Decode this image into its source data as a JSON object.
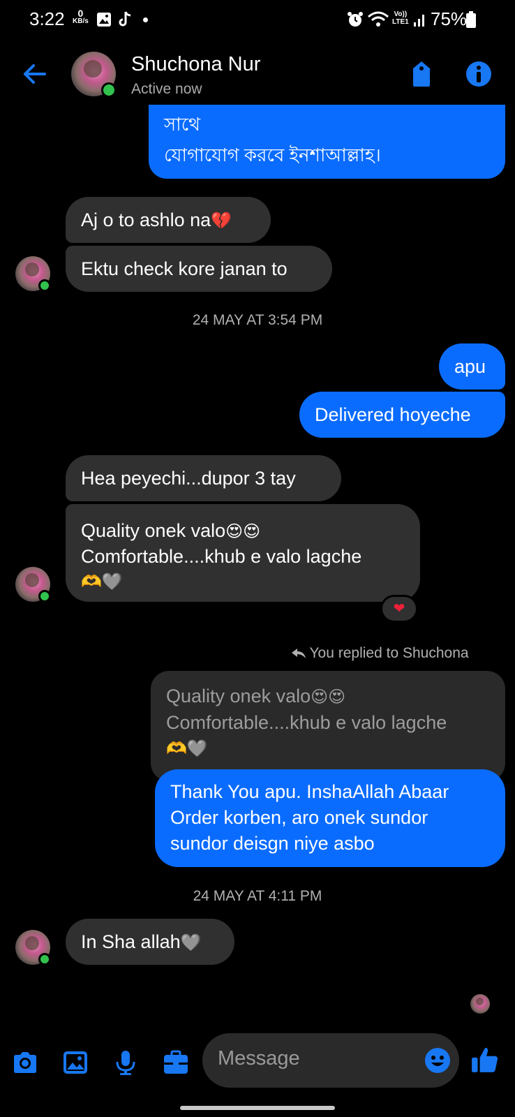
{
  "status_bar": {
    "time": "3:22",
    "net_speed_value": "0",
    "net_speed_unit": "KB/s",
    "volte_line1": "Vo))",
    "volte_line2": "LTE1",
    "battery": "75%"
  },
  "header": {
    "contact_name": "Shuchona Nur",
    "contact_status": "Active now"
  },
  "messages": {
    "m1_line1": "সাথে",
    "m1_line2": "যোগাযোগ করবে ইনশাআল্লাহ।",
    "m2": "Aj o to ashlo na",
    "m2_emoji": "💔",
    "m3": "Ektu check kore janan to",
    "ts1": "24 MAY AT 3:54 PM",
    "m4": "apu",
    "m5": "Delivered hoyeche",
    "m6": "Hea peyechi...dupor 3 tay",
    "m7_line1": "Quality onek valo",
    "m7_line1_emoji": "😍😍",
    "m7_line2": "Comfortable....khub e valo lagche",
    "m7_line3_emoji": "🫶🩶",
    "m7_reaction": "❤",
    "reply_label": "You replied to Shuchona",
    "quote_line1": "Quality onek valo",
    "quote_line1_emoji": "😍😍",
    "quote_line2": "Comfortable....khub e valo lagche",
    "quote_line3_emoji": "🫶🩶",
    "m8_line1": "Thank You apu. InshaAllah Abaar",
    "m8_line2": "Order korben, aro onek sundor",
    "m8_line3": "sundor deisgn niye asbo",
    "ts2": "24 MAY AT 4:11 PM",
    "m9": "In Sha allah",
    "m9_emoji": "🩶"
  },
  "composer": {
    "placeholder": "Message"
  },
  "icons": {
    "accent": "#0a6cff",
    "icon_blue": "#1877f2",
    "online": "#31c24d",
    "list": [
      "back-arrow-icon",
      "tag-icon",
      "info-icon",
      "camera-icon",
      "gallery-icon",
      "microphone-icon",
      "briefcase-icon",
      "emoji-icon",
      "thumbs-up-icon"
    ]
  }
}
